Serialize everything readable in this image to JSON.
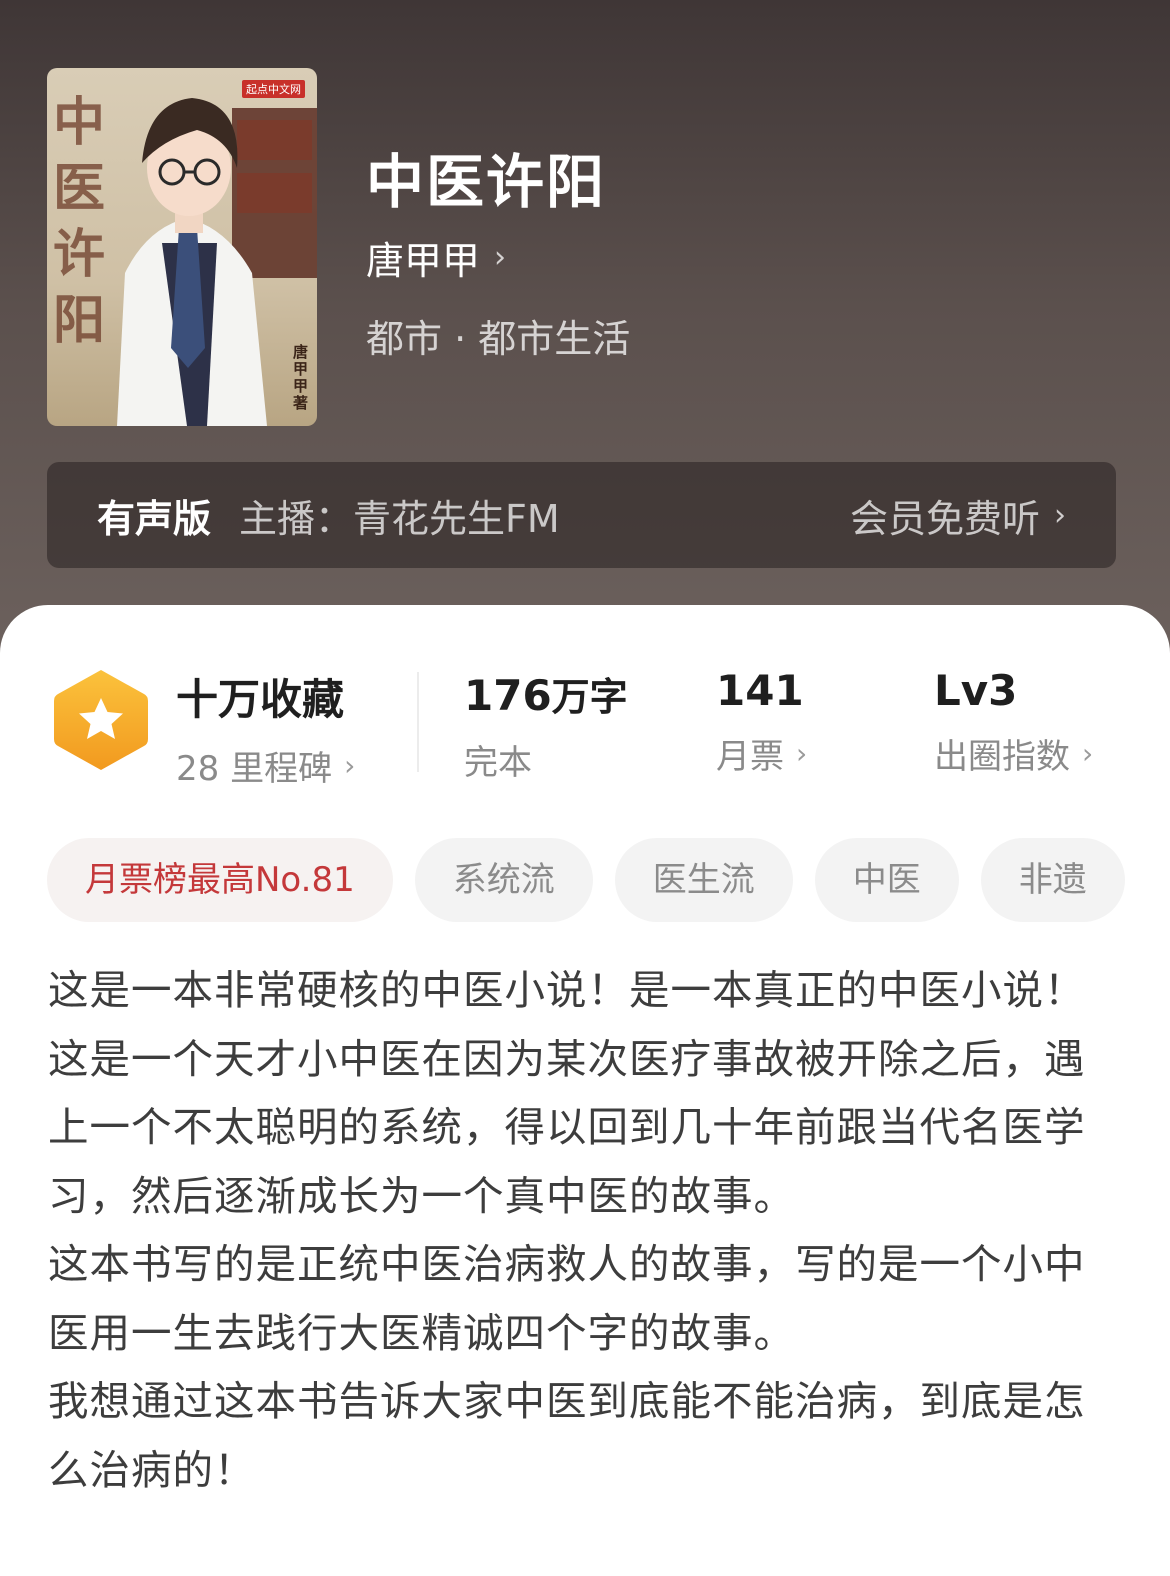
{
  "book": {
    "title": "中医许阳",
    "author": "唐甲甲",
    "genre": "都市 · 都市生活",
    "cover": {
      "title": "中医许阳",
      "publisher": "起点中文网",
      "author_credit": "唐甲甲著"
    }
  },
  "audio": {
    "label": "有声版",
    "host": "主播：青花先生FM",
    "action": "会员免费听"
  },
  "stats": {
    "collection": {
      "main": "十万收藏",
      "sub": "28 里程碑"
    },
    "words": {
      "number": "176",
      "unit": "万字",
      "sub": "完本"
    },
    "tickets": {
      "main": "141",
      "sub": "月票"
    },
    "level": {
      "main": "Lv3",
      "sub": "出圈指数"
    }
  },
  "tags": [
    "月票榜最高No.81",
    "系统流",
    "医生流",
    "中医",
    "非遗"
  ],
  "description": [
    "这是一本非常硬核的中医小说！是一本真正的中医小说！",
    "这是一个天才小中医在因为某次医疗事故被开除之后，遇上一个不太聪明的系统，得以回到几十年前跟当代名医学习，然后逐渐成长为一个真中医的故事。",
    "这本书写的是正统中医治病救人的故事，写的是一个小中医用一生去践行大医精诚四个字的故事。",
    "我想通过这本书告诉大家中医到底能不能治病，到底是怎么治病的！"
  ],
  "icons": {
    "badge": "star-hexagon-icon",
    "chevron": "chevron-right-icon"
  },
  "colors": {
    "header_dark": "#3f3636",
    "badge_orange": "#f6a423",
    "rank_tag_red": "#c4383a"
  }
}
